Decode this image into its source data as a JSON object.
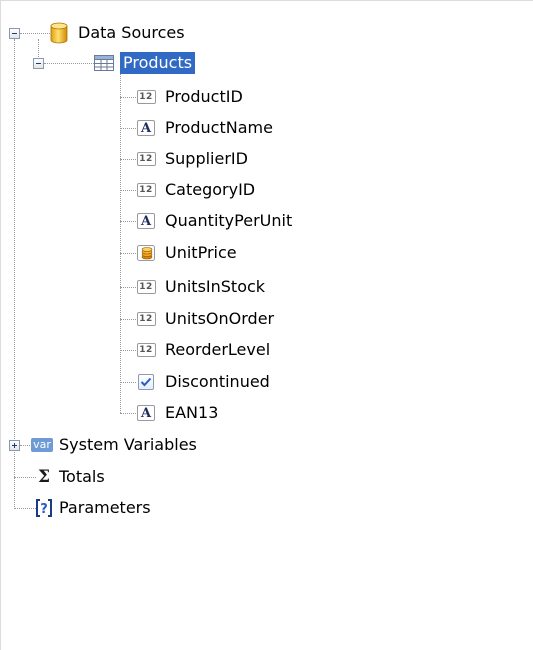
{
  "tree": {
    "root": {
      "label": "Data Sources",
      "icon": "database-icon",
      "expanded": true
    },
    "table": {
      "label": "Products",
      "icon": "table-icon",
      "expanded": true,
      "selected": true
    },
    "fields": [
      {
        "label": "ProductID",
        "icon": "number-field-icon",
        "badge": "12"
      },
      {
        "label": "ProductName",
        "icon": "text-field-icon",
        "badge": "A"
      },
      {
        "label": "SupplierID",
        "icon": "number-field-icon",
        "badge": "12"
      },
      {
        "label": "CategoryID",
        "icon": "number-field-icon",
        "badge": "12"
      },
      {
        "label": "QuantityPerUnit",
        "icon": "text-field-icon",
        "badge": "A"
      },
      {
        "label": "UnitPrice",
        "icon": "currency-field-icon",
        "badge": ""
      },
      {
        "label": "UnitsInStock",
        "icon": "number-field-icon",
        "badge": "12"
      },
      {
        "label": "UnitsOnOrder",
        "icon": "number-field-icon",
        "badge": "12"
      },
      {
        "label": "ReorderLevel",
        "icon": "number-field-icon",
        "badge": "12"
      },
      {
        "label": "Discontinued",
        "icon": "boolean-field-icon",
        "badge": ""
      },
      {
        "label": "EAN13",
        "icon": "text-field-icon",
        "badge": "A"
      }
    ],
    "system_variables": {
      "label": "System Variables",
      "icon": "variables-icon",
      "badge": "var",
      "expanded": false
    },
    "totals": {
      "label": "Totals",
      "icon": "sigma-icon",
      "badge": "Σ"
    },
    "parameters": {
      "label": "Parameters",
      "icon": "parameters-icon",
      "badge": "[?]"
    }
  },
  "colors": {
    "selection": "#316ac5",
    "selection_text": "#ffffff",
    "tree_line": "#9a9a9a",
    "var_badge": "#6e9ad6"
  }
}
